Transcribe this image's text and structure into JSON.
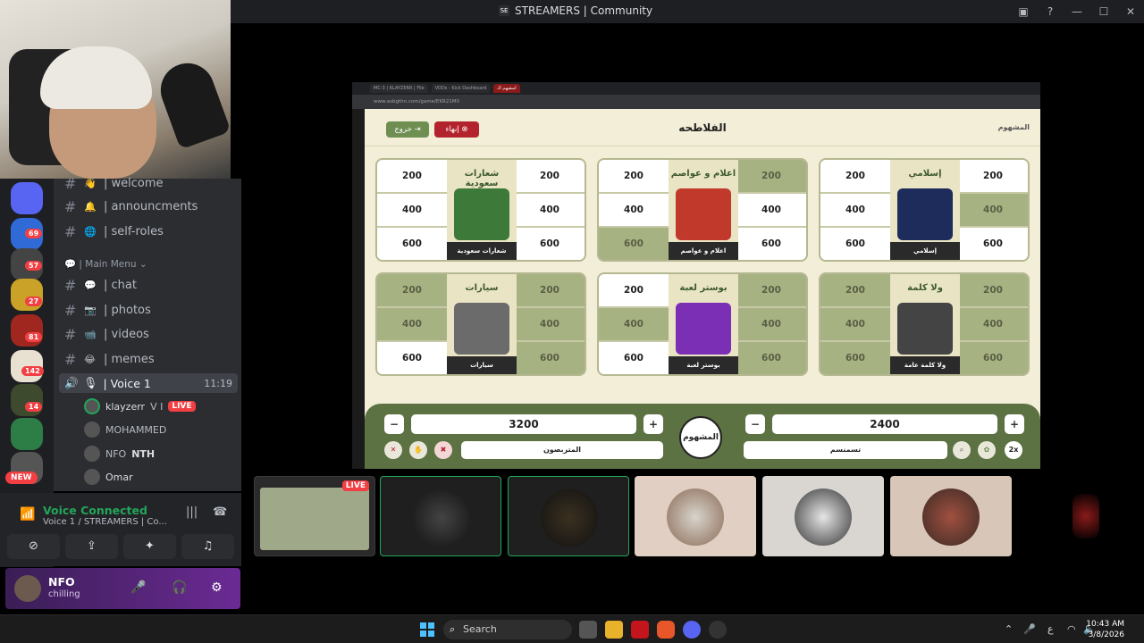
{
  "window": {
    "title": "STREAMERS | Community",
    "logo_text": "SE"
  },
  "channels": [
    {
      "emoji": "👋",
      "label": "| welcome"
    },
    {
      "emoji": "🔔",
      "label": "| announcments"
    },
    {
      "emoji": "🌐",
      "label": "| self-roles"
    },
    {
      "emoji": "💬",
      "label": "| chat"
    },
    {
      "emoji": "📷",
      "label": "| photos"
    },
    {
      "emoji": "📹",
      "label": "| videos"
    },
    {
      "emoji": "😂",
      "label": "| memes"
    }
  ],
  "category": "| Main Menu",
  "voice_channel": {
    "label": "| Voice 1",
    "time": "11:19"
  },
  "voice_users": [
    {
      "name": "klayzerr",
      "extra": "V I",
      "live": "LIVE"
    },
    {
      "name": "MOHAMMED",
      "extra": "",
      "live": ""
    },
    {
      "name": "NFO",
      "extra": "NTH",
      "live": ""
    },
    {
      "name": "Omar",
      "extra": "",
      "live": ""
    }
  ],
  "server_badges": [
    "69",
    "57",
    "27",
    "81",
    "142",
    "14"
  ],
  "new_badge": "NEW",
  "voice_panel": {
    "status": "Voice Connected",
    "sub": "Voice 1 / STREAMERS | Co..."
  },
  "user": {
    "name": "NFO",
    "status": "chilling"
  },
  "browser": {
    "tabs": [
      "MC-3 | KLAYZERR | File",
      "VODs - Kick Dashboard",
      "اسقيهم الـ"
    ],
    "url": "www.asbgthn.com/game/EKR21M0"
  },
  "game": {
    "title": "الفلاطحه",
    "exit_label": "خروج ⇥",
    "end_label": "إنهاء ⊗",
    "logo": "المشهوم",
    "categories": [
      {
        "title": "شعارات سعودية",
        "caption": "شعارات سعودية",
        "left": [
          "200",
          "400",
          "600"
        ],
        "right": [
          "200",
          "400",
          "600"
        ],
        "left_used": [
          false,
          false,
          false
        ],
        "right_used": [
          false,
          false,
          false
        ],
        "color": "#3d7a3a"
      },
      {
        "title": "اعلام و عواصم",
        "caption": "اعلام و عواصم",
        "left": [
          "200",
          "400",
          "600"
        ],
        "right": [
          "200",
          "400",
          "600"
        ],
        "left_used": [
          false,
          false,
          true
        ],
        "right_used": [
          true,
          false,
          false
        ],
        "color": "#c0392b"
      },
      {
        "title": "إسلامي",
        "caption": "إسلامي",
        "left": [
          "200",
          "400",
          "600"
        ],
        "right": [
          "200",
          "400",
          "600"
        ],
        "left_used": [
          false,
          false,
          false
        ],
        "right_used": [
          false,
          true,
          false
        ],
        "color": "#1d2c5a"
      },
      {
        "title": "سيارات",
        "caption": "سيارات",
        "left": [
          "200",
          "400",
          "600"
        ],
        "right": [
          "200",
          "400",
          "600"
        ],
        "left_used": [
          true,
          true,
          false
        ],
        "right_used": [
          true,
          true,
          true
        ],
        "color": "#6b6b6b"
      },
      {
        "title": "بوستر لعبة",
        "caption": "بوستر لعبة",
        "left": [
          "200",
          "400",
          "600"
        ],
        "right": [
          "200",
          "400",
          "600"
        ],
        "left_used": [
          false,
          true,
          false
        ],
        "right_used": [
          true,
          true,
          true
        ],
        "color": "#7b2fb5"
      },
      {
        "title": "ولا كلمة",
        "caption": "ولا كلمة عامة",
        "left": [
          "200",
          "400",
          "600"
        ],
        "right": [
          "200",
          "400",
          "600"
        ],
        "left_used": [
          true,
          true,
          true
        ],
        "right_used": [
          true,
          true,
          true
        ],
        "color": "#444"
      }
    ],
    "score_left": "3200",
    "score_right": "2400",
    "team_left": "المتربصون",
    "team_right": "تسمنسم",
    "minus": "−",
    "plus": "+",
    "double": "2x"
  },
  "participants": {
    "live_tag": "LIVE"
  },
  "taskbar": {
    "search": "Search",
    "lang": "ع",
    "time": "10:43 AM",
    "date": "3/8/2026"
  }
}
